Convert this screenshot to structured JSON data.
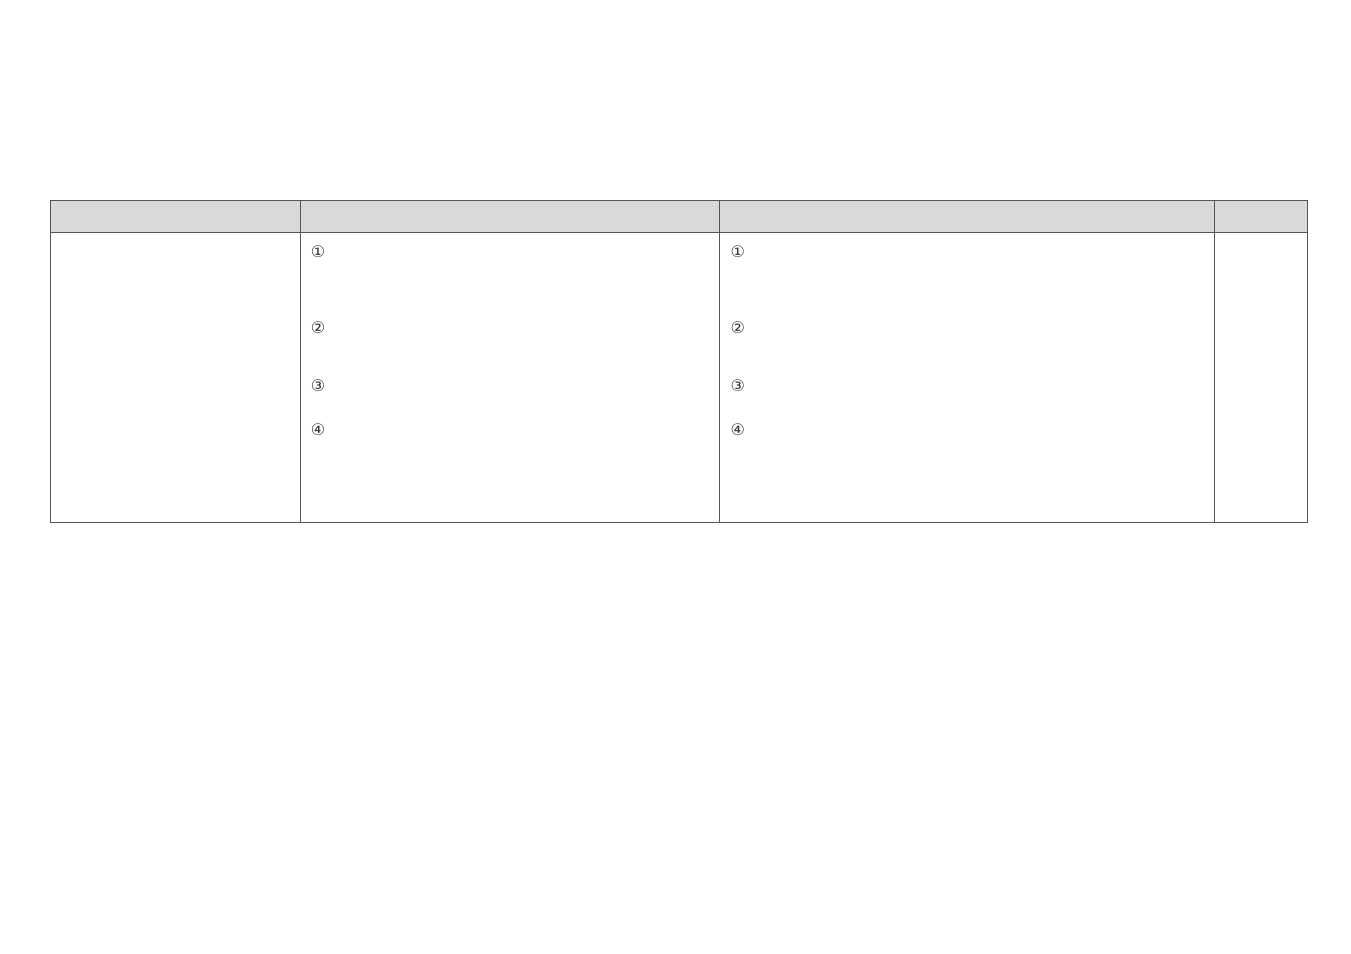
{
  "table": {
    "headers": [
      "",
      "",
      "",
      ""
    ],
    "rows": [
      {
        "col_a": "",
        "col_b": [
          "①",
          "②",
          "③",
          "④"
        ],
        "col_c": [
          "①",
          "②",
          "③",
          "④"
        ],
        "col_d": ""
      }
    ]
  }
}
